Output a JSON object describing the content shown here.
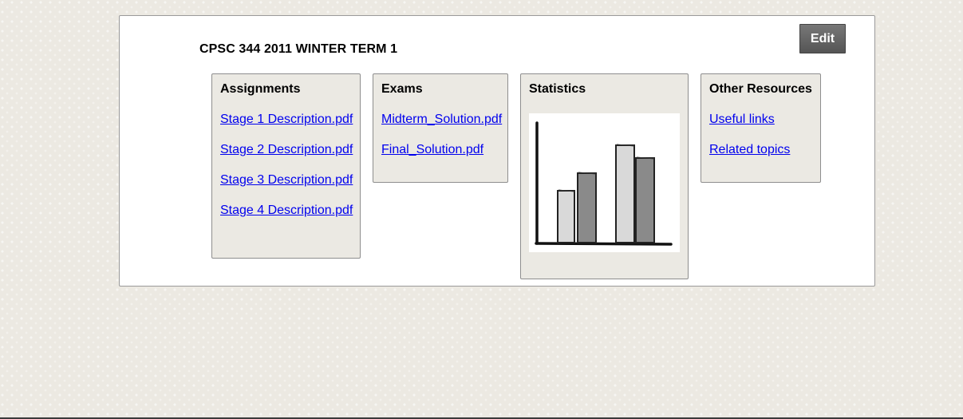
{
  "course": {
    "title": "CPSC 344 2011 WINTER TERM 1"
  },
  "toolbar": {
    "edit_label": "Edit"
  },
  "sections": {
    "assignments": {
      "title": "Assignments",
      "links": [
        "Stage 1 Description.pdf",
        "Stage 2 Description.pdf",
        "Stage 3 Description.pdf",
        "Stage 4 Description.pdf"
      ]
    },
    "exams": {
      "title": "Exams",
      "links": [
        "Midterm_Solution.pdf",
        "Final_Solution.pdf"
      ]
    },
    "statistics": {
      "title": "Statistics",
      "image_icon": "bar-chart-icon"
    },
    "resources": {
      "title": "Other Resources",
      "links": [
        "Useful links",
        "Related topics"
      ]
    }
  },
  "colors": {
    "link": "#0000ee",
    "box_background": "#ebe9e3",
    "edit_button": "#666666",
    "bar_light": "#d9d9d9",
    "bar_dark": "#8a8a8a"
  }
}
